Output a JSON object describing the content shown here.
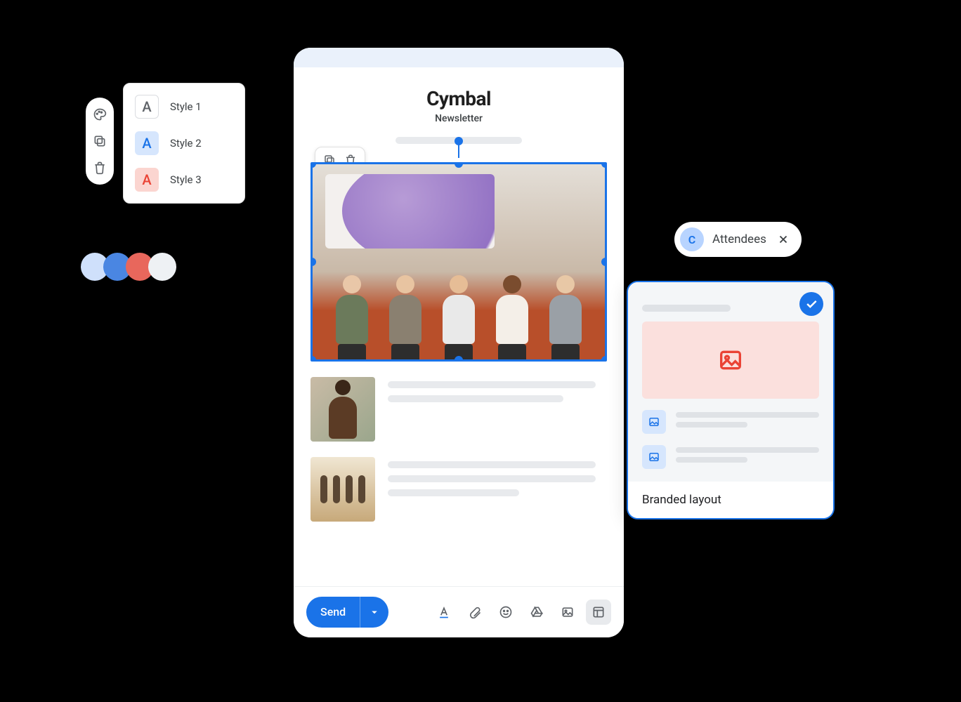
{
  "style_picker": {
    "items": [
      {
        "glyph": "A",
        "label": "Style 1"
      },
      {
        "glyph": "A",
        "label": "Style 2"
      },
      {
        "glyph": "A",
        "label": "Style 3"
      }
    ]
  },
  "palette": {
    "colors": [
      "#cfe0fb",
      "#4a86e2",
      "#e8675c",
      "#eef1f4"
    ]
  },
  "editor": {
    "brand_title": "Cymbal",
    "brand_subtitle": "Newsletter",
    "send_label": "Send"
  },
  "chip": {
    "avatar_letter": "C",
    "label": "Attendees"
  },
  "layout_card": {
    "footer": "Branded layout"
  }
}
